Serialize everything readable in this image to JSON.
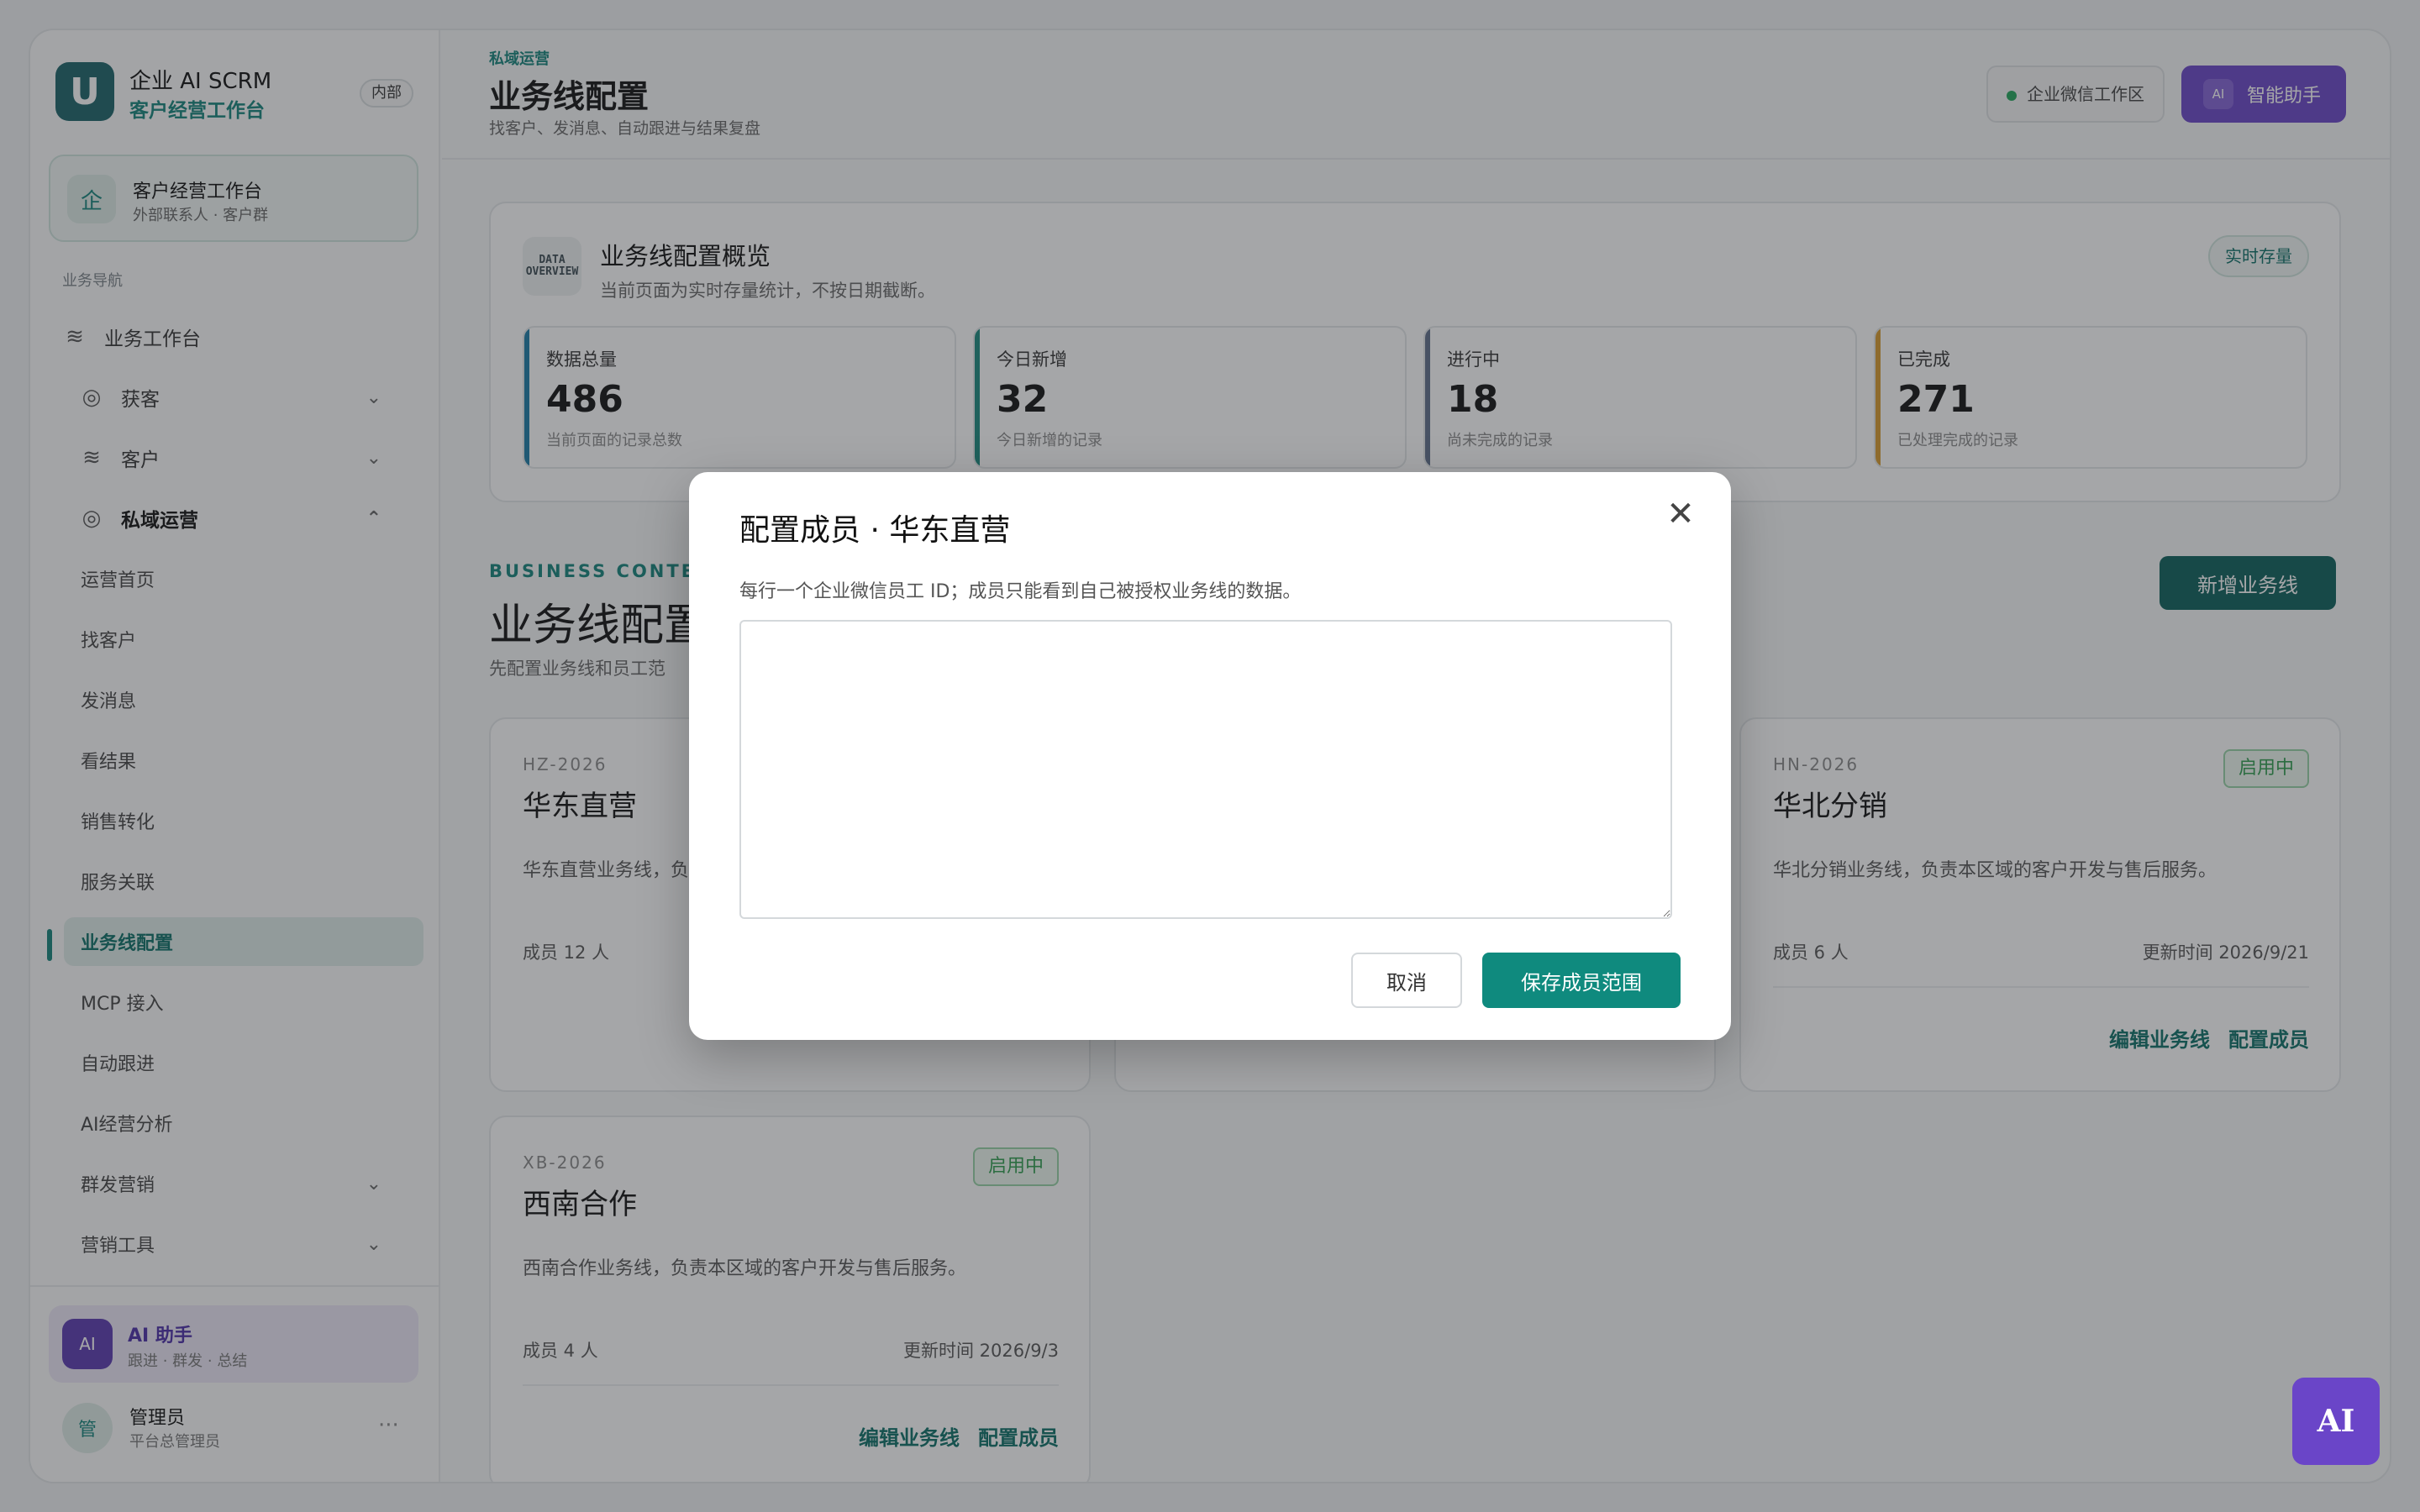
{
  "brand": {
    "title": "企业 AI SCRM",
    "subtitle": "客户经营工作台",
    "badge": "内部",
    "logo": "U"
  },
  "workspace": {
    "icon": "企",
    "title": "客户经营工作台",
    "subtitle": "外部联系人 · 客户群"
  },
  "sidebar": {
    "heading": "业务导航",
    "top_item": "业务工作台",
    "groups": {
      "acquire": "获客",
      "customer": "客户",
      "private": "私域运营",
      "mass": "群发营销",
      "tools": "营销工具"
    },
    "sub_items": [
      "运营首页",
      "找客户",
      "发消息",
      "看结果",
      "销售转化",
      "服务关联",
      "业务线配置",
      "MCP 接入",
      "自动跟进",
      "AI经营分析"
    ]
  },
  "ai_card": {
    "avatar": "AI",
    "title": "AI 助手",
    "subtitle": "跟进 · 群发 · 总结"
  },
  "user": {
    "avatar": "管",
    "name": "管理员",
    "role": "平台总管理员",
    "more": "···"
  },
  "header": {
    "crumb": "私域运营",
    "title": "业务线配置",
    "subtitle": "找客户、发消息、自动跟进与结果复盘",
    "workspace_pill": "企业微信工作区",
    "assistant_icon": "AI",
    "assistant_label": "智能助手"
  },
  "overview": {
    "icon_text": "DATA OVERVIEW",
    "title": "业务线配置概览",
    "subtitle": "当前页面为实时存量统计，不按日期截断。",
    "badge": "实时存量",
    "stats": [
      {
        "label": "数据总量",
        "value": "486",
        "note": "当前页面的记录总数",
        "color": "#1b7aa6"
      },
      {
        "label": "今日新增",
        "value": "32",
        "note": "今日新增的记录",
        "color": "#19897c"
      },
      {
        "label": "进行中",
        "value": "18",
        "note": "尚未完成的记录",
        "color": "#5f6f8a"
      },
      {
        "label": "已完成",
        "value": "271",
        "note": "已处理完成的记录",
        "color": "#d79a2b"
      }
    ]
  },
  "business_context": {
    "kicker": "BUSINESS CONTEXT",
    "title": "业务线配置",
    "subtitle": "先配置业务线和员工范",
    "add_button": "新增业务线"
  },
  "cards": [
    {
      "code": "HZ-2026",
      "name": "华东直营",
      "desc": "华东直营业务线，负",
      "members": "成员 12 人"
    },
    {
      "code": "HN-2026",
      "name": "华北分销",
      "status": "启用中",
      "desc": "华北分销业务线，负责本区域的客户开发与售后服务。",
      "members": "成员 6 人",
      "updated": "更新时间 2026/9/21",
      "edit": "编辑业务线",
      "config": "配置成员"
    },
    {
      "code": "XB-2026",
      "name": "西南合作",
      "status": "启用中",
      "desc": "西南合作业务线，负责本区域的客户开发与售后服务。",
      "members": "成员 4 人",
      "updated": "更新时间 2026/9/3",
      "edit": "编辑业务线",
      "config": "配置成员"
    }
  ],
  "modal": {
    "title": "配置成员 · 华东直营",
    "close": "✕",
    "hint": "每行一个企业微信员工 ID；成员只能看到自己被授权业务线的数据。",
    "textarea_value": "",
    "cancel": "取消",
    "save": "保存成员范围"
  },
  "fab": {
    "label": "AI"
  }
}
